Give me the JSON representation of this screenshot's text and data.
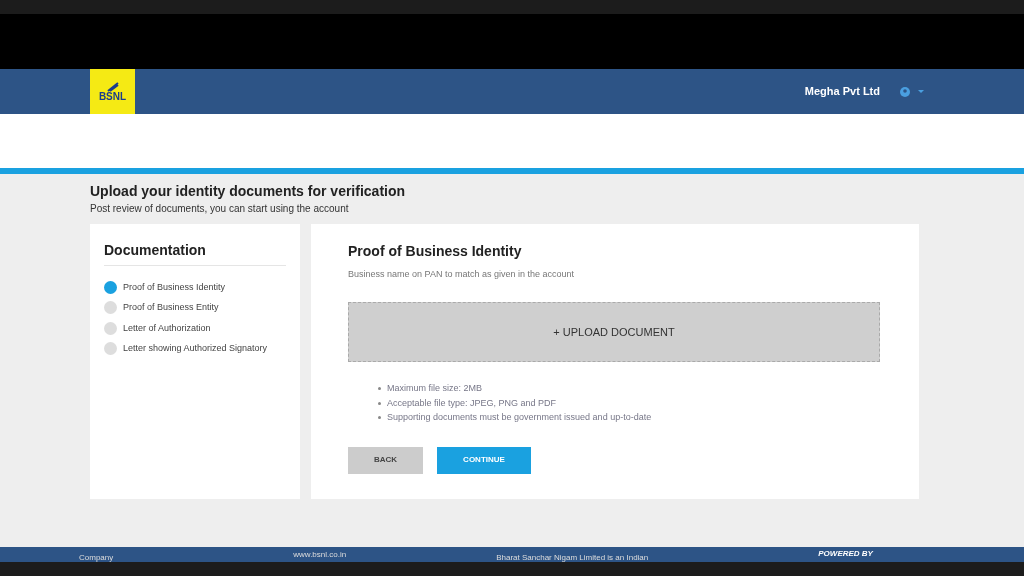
{
  "header": {
    "logo": "BSNL",
    "account": "Megha Pvt Ltd"
  },
  "page": {
    "title": "Upload your identity documents for verification",
    "subtitle": "Post review of documents, you can start using the account"
  },
  "sidebar": {
    "title": "Documentation",
    "steps": [
      {
        "label": "Proof of Business Identity",
        "selected": true
      },
      {
        "label": "Proof of Business Entity",
        "selected": false
      },
      {
        "label": "Letter of Authorization",
        "selected": false
      },
      {
        "label": "Letter showing Authorized Signatory",
        "selected": false
      }
    ]
  },
  "main": {
    "title": "Proof of Business Identity",
    "hint": "Business name on PAN to match as given in the account",
    "upload": "+ UPLOAD DOCUMENT",
    "notes": [
      "Maximum file size: 2MB",
      "Acceptable file type: JPEG, PNG and PDF",
      "Supporting documents must be government issued and up-to-date"
    ],
    "buttons": [
      {
        "label": "BACK",
        "kind": "secondary"
      },
      {
        "label": "CONTINUE",
        "kind": "primary"
      }
    ]
  },
  "footer": [
    "Company",
    "www.bsnl.co.in",
    "Bharat Sanchar Nigam Limited is an Indian",
    "POWERED BY"
  ]
}
